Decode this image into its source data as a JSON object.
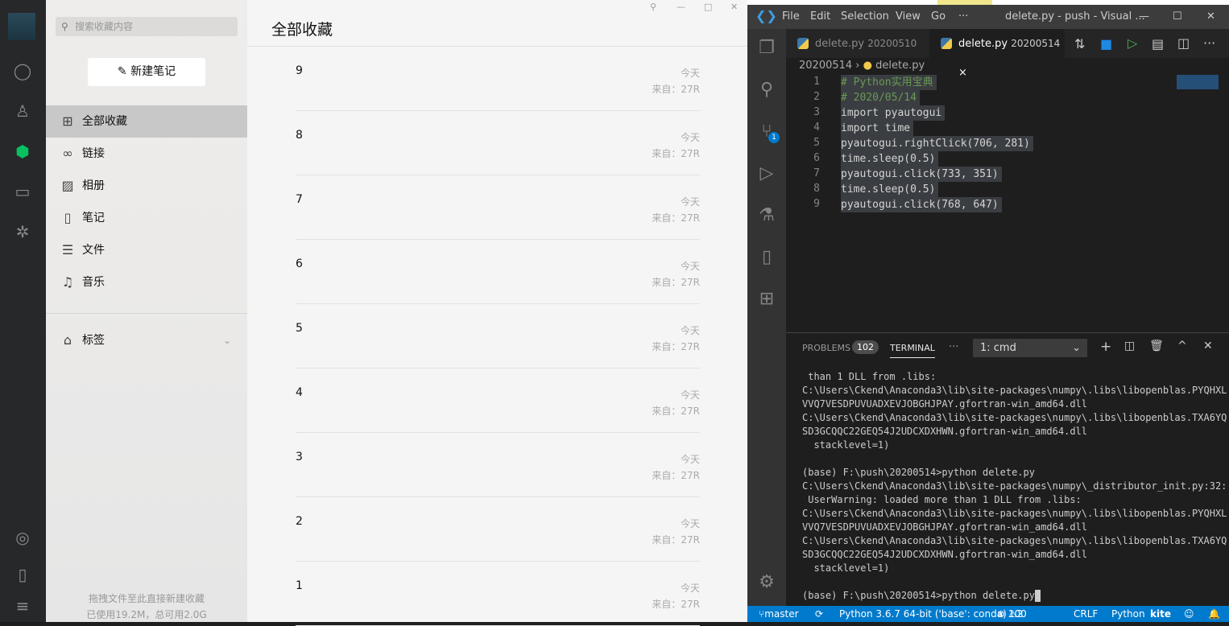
{
  "wechat_nav": {
    "icons": [
      "chat-icon",
      "contacts-icon",
      "favorites-cube-icon",
      "files-folder-icon",
      "moments-icon",
      "miniprogram-icon",
      "phone-icon",
      "menu-icon"
    ],
    "active_color": "#07c160"
  },
  "favorites_sidebar": {
    "search_placeholder": "搜索收藏内容",
    "new_note": "新建笔记",
    "categories": [
      {
        "label": "全部收藏",
        "icon": "grid-icon"
      },
      {
        "label": "链接",
        "icon": "link-icon"
      },
      {
        "label": "相册",
        "icon": "image-icon"
      },
      {
        "label": "笔记",
        "icon": "notebook-icon"
      },
      {
        "label": "文件",
        "icon": "file-icon"
      },
      {
        "label": "音乐",
        "icon": "music-icon"
      }
    ],
    "tags": "标签",
    "footer_hint": "拖拽文件至此直接新建收藏",
    "storage": "已使用19.2M，总可用2.0G"
  },
  "favorites_main": {
    "title": "全部收藏",
    "items": [
      {
        "title": "9",
        "date": "今天",
        "from": "来自：27R"
      },
      {
        "title": "8",
        "date": "今天",
        "from": "来自：27R"
      },
      {
        "title": "7",
        "date": "今天",
        "from": "来自：27R"
      },
      {
        "title": "6",
        "date": "今天",
        "from": "来自：27R"
      },
      {
        "title": "5",
        "date": "今天",
        "from": "来自：27R"
      },
      {
        "title": "4",
        "date": "今天",
        "from": "来自：27R"
      },
      {
        "title": "3",
        "date": "今天",
        "from": "来自：27R"
      },
      {
        "title": "2",
        "date": "今天",
        "from": "来自：27R"
      },
      {
        "title": "1",
        "date": "今天",
        "from": "来自：27R"
      }
    ]
  },
  "vscode": {
    "menu": [
      "File",
      "Edit",
      "Selection",
      "View",
      "Go",
      "···"
    ],
    "title": "delete.py - push - Visual ...",
    "tabs": [
      {
        "name": "delete.py",
        "folder": "20200510"
      },
      {
        "name": "delete.py",
        "folder": "20200514",
        "close": "×"
      }
    ],
    "breadcrumb": {
      "folder": "20200514",
      "file": "delete.py"
    },
    "code": [
      "# Python实用宝典",
      "# 2020/05/14",
      "import pyautogui",
      "import time",
      "pyautogui.rightClick(706, 281)",
      "time.sleep(0.5)",
      "pyautogui.click(733, 351)",
      "time.sleep(0.5)",
      "pyautogui.click(768, 647)"
    ],
    "scm_badge": "1",
    "panel": {
      "problems": "PROBLEMS",
      "problems_count": "102",
      "terminal": "TERMINAL",
      "more": "···",
      "terminal_select": "1: cmd"
    },
    "terminal_lines": [
      " than 1 DLL from .libs:",
      "C:\\Users\\Ckend\\Anaconda3\\lib\\site-packages\\numpy\\.libs\\libopenblas.PYQHXL",
      "VVQ7VESDPUVUADXEVJOBGHJPAY.gfortran-win_amd64.dll",
      "C:\\Users\\Ckend\\Anaconda3\\lib\\site-packages\\numpy\\.libs\\libopenblas.TXA6YQ",
      "SD3GCQQC22GEQ54J2UDCXDXHWN.gfortran-win_amd64.dll",
      "  stacklevel=1)",
      "",
      "(base) F:\\push\\20200514>python delete.py",
      "C:\\Users\\Ckend\\Anaconda3\\lib\\site-packages\\numpy\\_distributor_init.py:32:",
      " UserWarning: loaded more than 1 DLL from .libs:",
      "C:\\Users\\Ckend\\Anaconda3\\lib\\site-packages\\numpy\\.libs\\libopenblas.PYQHXL",
      "VVQ7VESDPUVUADXEVJOBGHJPAY.gfortran-win_amd64.dll",
      "C:\\Users\\Ckend\\Anaconda3\\lib\\site-packages\\numpy\\.libs\\libopenblas.TXA6YQ",
      "SD3GCQQC22GEQ54J2UDCXDXHWN.gfortran-win_amd64.dll",
      "  stacklevel=1)",
      "",
      "(base) F:\\push\\20200514>python delete.py"
    ],
    "status": {
      "branch": "master",
      "interpreter": "Python 3.6.7 64-bit ('base': conda)",
      "errors": "100",
      "warnings": "2",
      "eol": "CRLF",
      "language": "Python",
      "kite": "kite"
    },
    "status_color": "#007acc"
  }
}
